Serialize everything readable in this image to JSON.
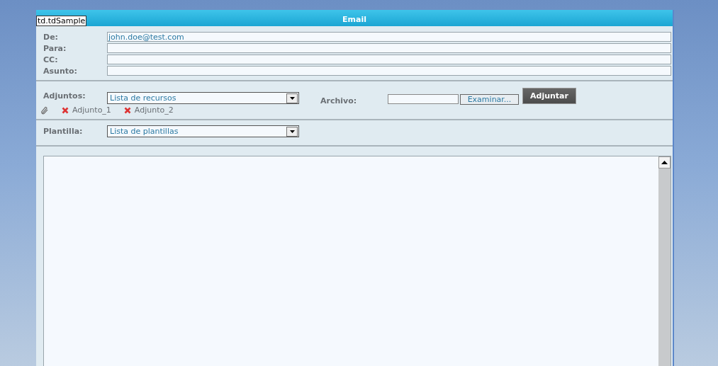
{
  "tooltip": "td.tdSample",
  "window": {
    "title": "Email"
  },
  "fields": [
    {
      "label": "De:",
      "value": "john.doe@test.com"
    },
    {
      "label": "Para:"
    },
    {
      "label": "CC:"
    },
    {
      "label": "Asunto:"
    }
  ],
  "attachments": {
    "label": "Adjuntos:",
    "select": "Lista de recursos",
    "file_label": "Archivo:",
    "browse_button": "Examinar...",
    "attach_button": "Adjuntar",
    "items": [
      "Adjunto_1",
      "Adjunto_2"
    ]
  },
  "template": {
    "label": "Plantilla:",
    "select": "Lista de plantillas"
  }
}
